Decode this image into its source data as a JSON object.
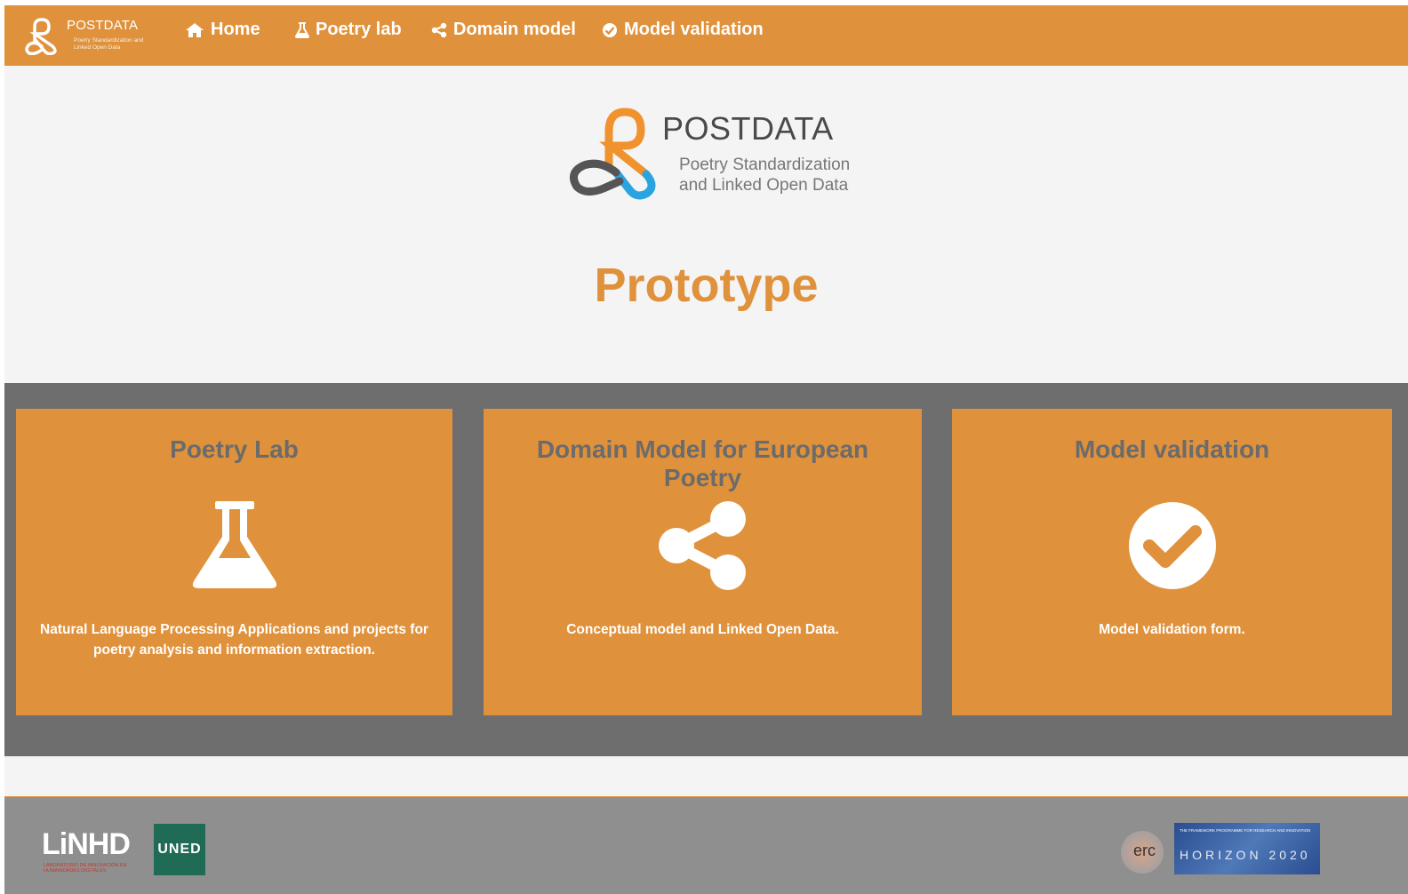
{
  "navbar": {
    "brand_title": "POSTDATA",
    "brand_subtitle": "Poetry Standardization and Linked Open Data",
    "links": [
      {
        "label": "Home",
        "icon": "home-icon"
      },
      {
        "label": "Poetry lab",
        "icon": "flask-icon"
      },
      {
        "label": "Domain model",
        "icon": "share-icon"
      },
      {
        "label": "Model validation",
        "icon": "check-circle-icon"
      }
    ]
  },
  "hero": {
    "logo_title": "POSTDATA",
    "logo_subtitle_line1": "Poetry Standardization",
    "logo_subtitle_line2": "and Linked Open Data",
    "page_title": "Prototype"
  },
  "cards": [
    {
      "title": "Poetry Lab",
      "icon": "flask-icon",
      "description": "Natural Language Processing Applications and projects for poetry analysis and information extraction."
    },
    {
      "title": "Domain Model for European Poetry",
      "icon": "share-icon",
      "description": "Conceptual model and Linked Open Data."
    },
    {
      "title": "Model validation",
      "icon": "check-circle-icon",
      "description": "Model validation form."
    }
  ],
  "footer": {
    "linhd_logo": "LiNHD",
    "linhd_subtitle": "LABORATORIO DE INNOVACIÓN EN HUMANIDADES DIGITALES",
    "uned_logo": "UNED",
    "erc_logo": "erc",
    "horizon_small": "THE FRAMEWORK PROGRAMME FOR RESEARCH AND INNOVATION",
    "horizon_logo": "HORIZON 2020"
  },
  "colors": {
    "accent": "#e0913b",
    "band": "#6e6e6e",
    "footer": "#8f8f8f",
    "card_title": "#6b6b6b"
  }
}
